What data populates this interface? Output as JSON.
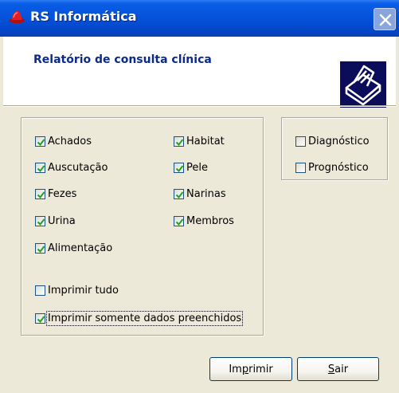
{
  "window": {
    "title": "RS Informática",
    "app_icon": "red-hat-icon",
    "close_icon": "close-icon"
  },
  "header": {
    "report_title": "Relatório de consulta clínica",
    "icon": "printer-icon"
  },
  "checkboxes": {
    "achados": {
      "label": "Achados",
      "checked": true
    },
    "auscutacao": {
      "label": "Auscutação",
      "checked": true
    },
    "fezes": {
      "label": "Fezes",
      "checked": true
    },
    "urina": {
      "label": "Urina",
      "checked": true
    },
    "alimentacao": {
      "label": "Alimentação",
      "checked": true
    },
    "habitat": {
      "label": "Habitat",
      "checked": true
    },
    "pele": {
      "label": "Pele",
      "checked": true
    },
    "narinas": {
      "label": "Narinas",
      "checked": true
    },
    "membros": {
      "label": "Membros",
      "checked": true
    },
    "imprimir_tudo": {
      "label": "Imprimir tudo",
      "checked": false
    },
    "somente_preenchidos": {
      "label": "Imprimir somente dados preenchidos",
      "checked": true
    },
    "diagnostico": {
      "label": "Diagnóstico",
      "checked": false
    },
    "prognostico": {
      "label": "Prognóstico",
      "checked": false
    }
  },
  "buttons": {
    "print": {
      "pre": "Im",
      "accel": "p",
      "post": "rimir"
    },
    "exit": {
      "pre": "",
      "accel": "S",
      "post": "air"
    }
  },
  "colors": {
    "titlebar": "#0450d8",
    "report_title": "#0b2a8c",
    "icon_bg": "#0b0c5a",
    "check": "#21a121"
  }
}
